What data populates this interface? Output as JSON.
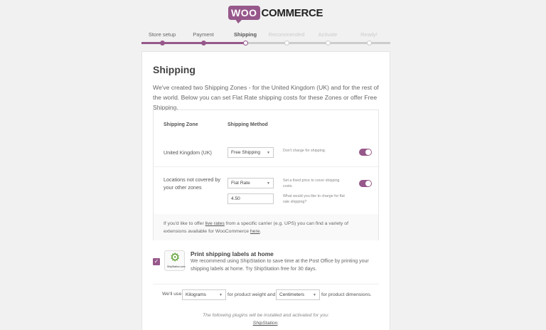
{
  "brand": {
    "woo": "WOO",
    "commerce": "COMMERCE",
    "accent": "#96588a"
  },
  "steps": [
    {
      "label": "Store setup",
      "state": "done"
    },
    {
      "label": "Payment",
      "state": "done"
    },
    {
      "label": "Shipping",
      "state": "active"
    },
    {
      "label": "Recommended",
      "state": "todo"
    },
    {
      "label": "Activate",
      "state": "todo"
    },
    {
      "label": "Ready!",
      "state": "todo"
    }
  ],
  "page": {
    "title": "Shipping",
    "intro": "We've created two Shipping Zones - for the United Kingdom (UK) and for the rest of the world. Below you can set Flat Rate shipping costs for these Zones or offer Free Shipping."
  },
  "zones_table": {
    "header_zone": "Shipping Zone",
    "header_method": "Shipping Method",
    "rows": [
      {
        "zone": "United Kingdom (UK)",
        "method": "Free Shipping",
        "description": "Don't charge for shipping.",
        "enabled": true
      },
      {
        "zone": "Locations not covered by your other zones",
        "method": "Flat Rate",
        "cost": "4.50",
        "description": "Set a fixed price to cover shipping costs.",
        "cost_description": "What would you like to charge for flat rate shipping?",
        "enabled": true
      }
    ],
    "footnote_pre": "If you'd like to offer",
    "footnote_link": "live rates",
    "footnote_mid": "from a specific carrier (e.g. UPS) you can find a variety of extensions available for WooCommerce",
    "footnote_link2": "here",
    "footnote_end": "."
  },
  "print_labels": {
    "checked": true,
    "logo_text": "ShipStation.com",
    "title": "Print shipping labels at home",
    "description": "We recommend using ShipStation to save time at the Post Office by printing your shipping labels at home. Try ShipStation free for 30 days."
  },
  "units": {
    "prefix": "We'll use",
    "weight": "Kilograms",
    "weight_suffix": "for product weight and",
    "dimension": "Centimeters",
    "dimension_suffix": "for product dimensions."
  },
  "plugins_note": {
    "text": "The following plugins will be installed and activated for you:",
    "link": "ShipStation",
    "end": "."
  }
}
